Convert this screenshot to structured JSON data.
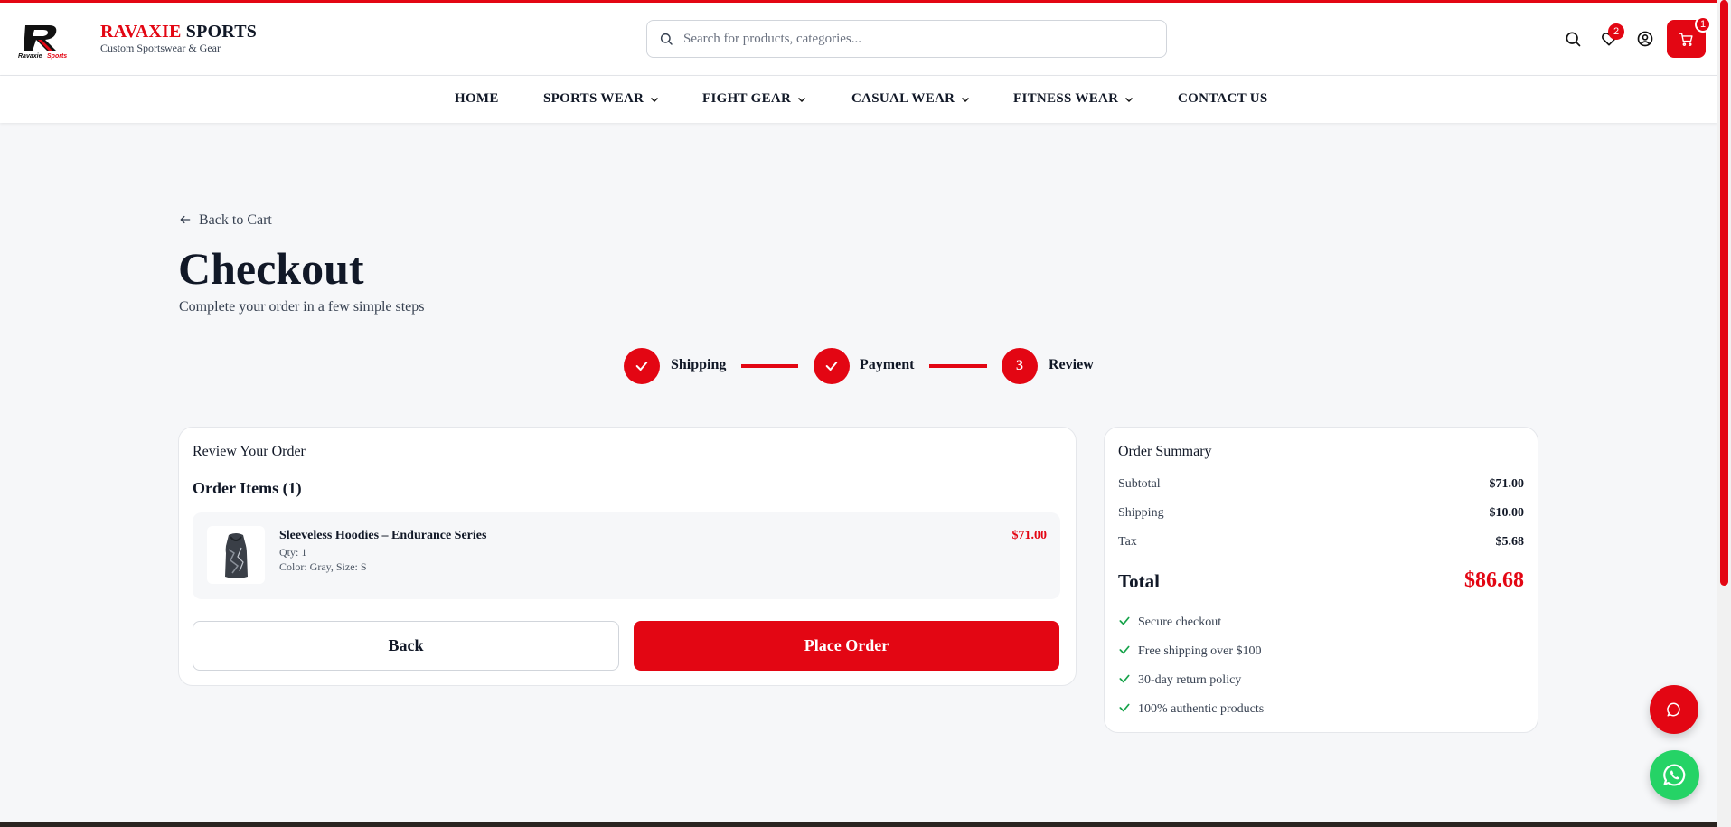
{
  "brand": {
    "name_red": "RAVAXIE",
    "name_dark": "SPORTS",
    "tagline": "Custom Sportswear & Gear",
    "logo_text": "Ravaxie Sports"
  },
  "search": {
    "placeholder": "Search for products, categories..."
  },
  "header_icons": {
    "wishlist_count": "2",
    "cart_count": "1"
  },
  "nav": {
    "home": "HOME",
    "sports_wear": "SPORTS WEAR",
    "fight_gear": "FIGHT GEAR",
    "casual_wear": "CASUAL WEAR",
    "fitness_wear": "FITNESS WEAR",
    "contact": "CONTACT US"
  },
  "page": {
    "back_link": "Back to Cart",
    "title": "Checkout",
    "subtitle": "Complete your order in a few simple steps"
  },
  "steps": [
    {
      "label": "Shipping",
      "state": "done"
    },
    {
      "label": "Payment",
      "state": "done"
    },
    {
      "label": "Review",
      "number": "3",
      "state": "active"
    }
  ],
  "review": {
    "title": "Review Your Order",
    "items_heading": "Order Items (1)",
    "items": [
      {
        "name": "Sleeveless Hoodies – Endurance Series",
        "qty": "Qty: 1",
        "options": "Color: Gray, Size: S",
        "price": "$71.00"
      }
    ],
    "back_button": "Back",
    "place_button": "Place Order"
  },
  "summary": {
    "title": "Order Summary",
    "subtotal_label": "Subtotal",
    "subtotal": "$71.00",
    "shipping_label": "Shipping",
    "shipping": "$10.00",
    "tax_label": "Tax",
    "tax": "$5.68",
    "total_label": "Total",
    "total": "$86.68",
    "features": [
      "Secure checkout",
      "Free shipping over $100",
      "30-day return policy",
      "100% authentic products"
    ]
  },
  "colors": {
    "accent": "#e30613",
    "whatsapp": "#25d366",
    "check": "#16a34a"
  }
}
